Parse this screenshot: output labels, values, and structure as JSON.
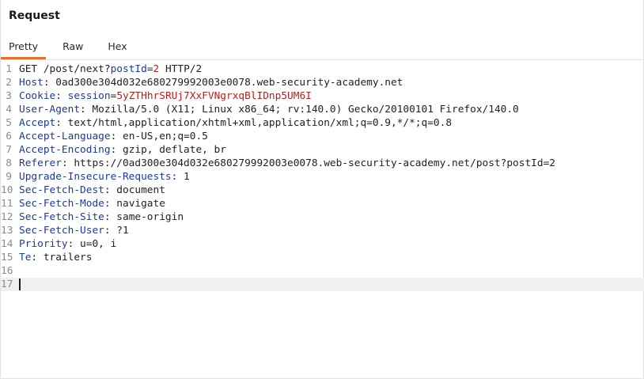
{
  "header": {
    "title": "Request"
  },
  "tabs": [
    {
      "label": "Pretty",
      "active": true
    },
    {
      "label": "Raw",
      "active": false
    },
    {
      "label": "Hex",
      "active": false
    }
  ],
  "accent_color": "#e8702a",
  "editor": {
    "current_line": 17,
    "lines": [
      {
        "num": "1",
        "parts": [
          {
            "t": "GET /post/next?",
            "c": ""
          },
          {
            "t": "postId",
            "c": "pname"
          },
          {
            "t": "=",
            "c": ""
          },
          {
            "t": "2",
            "c": "pval"
          },
          {
            "t": " HTTP/2",
            "c": ""
          }
        ]
      },
      {
        "num": "2",
        "parts": [
          {
            "t": "Host",
            "c": "hname"
          },
          {
            "t": ": 0ad300e304d032e680279992003e0078.web-security-academy.net",
            "c": ""
          }
        ]
      },
      {
        "num": "3",
        "parts": [
          {
            "t": "Cookie",
            "c": "hname"
          },
          {
            "t": ": ",
            "c": ""
          },
          {
            "t": "session",
            "c": "pname"
          },
          {
            "t": "=",
            "c": ""
          },
          {
            "t": "5yZTHhrSRUj7XxFVNgrxqBlIDnp5UM6I",
            "c": "pval"
          }
        ]
      },
      {
        "num": "4",
        "parts": [
          {
            "t": "User-Agent",
            "c": "hname"
          },
          {
            "t": ": Mozilla/5.0 (X11; Linux x86_64; rv:140.0) Gecko/20100101 Firefox/140.0",
            "c": ""
          }
        ]
      },
      {
        "num": "5",
        "parts": [
          {
            "t": "Accept",
            "c": "hname"
          },
          {
            "t": ": text/html,application/xhtml+xml,application/xml;q=0.9,*/*;q=0.8",
            "c": ""
          }
        ]
      },
      {
        "num": "6",
        "parts": [
          {
            "t": "Accept-Language",
            "c": "hname"
          },
          {
            "t": ": en-US,en;q=0.5",
            "c": ""
          }
        ]
      },
      {
        "num": "7",
        "parts": [
          {
            "t": "Accept-Encoding",
            "c": "hname"
          },
          {
            "t": ": gzip, deflate, br",
            "c": ""
          }
        ]
      },
      {
        "num": "8",
        "parts": [
          {
            "t": "Referer",
            "c": "hname"
          },
          {
            "t": ": https://0ad300e304d032e680279992003e0078.web-security-academy.net/post?postId=2",
            "c": ""
          }
        ]
      },
      {
        "num": "9",
        "parts": [
          {
            "t": "Upgrade-Insecure-Requests",
            "c": "hname"
          },
          {
            "t": ": 1",
            "c": ""
          }
        ]
      },
      {
        "num": "10",
        "parts": [
          {
            "t": "Sec-Fetch-Dest",
            "c": "hname"
          },
          {
            "t": ": document",
            "c": ""
          }
        ]
      },
      {
        "num": "11",
        "parts": [
          {
            "t": "Sec-Fetch-Mode",
            "c": "hname"
          },
          {
            "t": ": navigate",
            "c": ""
          }
        ]
      },
      {
        "num": "12",
        "parts": [
          {
            "t": "Sec-Fetch-Site",
            "c": "hname"
          },
          {
            "t": ": same-origin",
            "c": ""
          }
        ]
      },
      {
        "num": "13",
        "parts": [
          {
            "t": "Sec-Fetch-User",
            "c": "hname"
          },
          {
            "t": ": ?1",
            "c": ""
          }
        ]
      },
      {
        "num": "14",
        "parts": [
          {
            "t": "Priority",
            "c": "hname"
          },
          {
            "t": ": u=0, i",
            "c": ""
          }
        ]
      },
      {
        "num": "15",
        "parts": [
          {
            "t": "Te",
            "c": "hname"
          },
          {
            "t": ": trailers",
            "c": ""
          }
        ]
      },
      {
        "num": "16",
        "parts": []
      },
      {
        "num": "17",
        "parts": []
      }
    ]
  }
}
